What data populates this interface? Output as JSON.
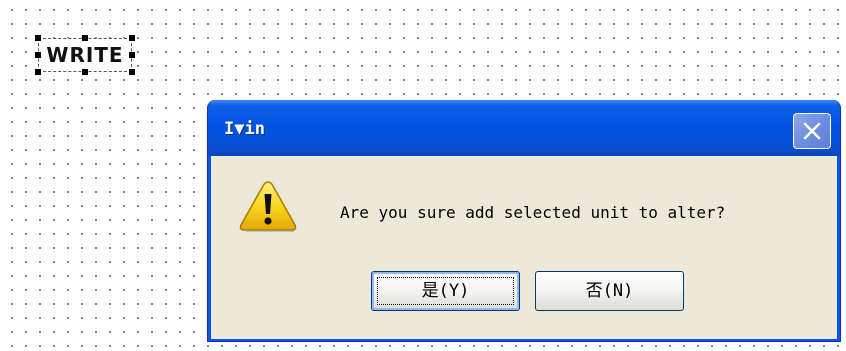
{
  "canvas": {
    "selected_control_text": "WRITE"
  },
  "dialog": {
    "title": "I▼in",
    "message": "Are you sure add selected unit to alter?",
    "icon": "warning-icon",
    "close_icon": "close-icon",
    "buttons": {
      "yes_label": "是(Y)",
      "no_label": "否(N)"
    }
  },
  "colors": {
    "titlebar": "#0453e3",
    "client_background": "#ece9d8",
    "warning_yellow": "#f7d21b",
    "close_button": "#6e8ede"
  }
}
